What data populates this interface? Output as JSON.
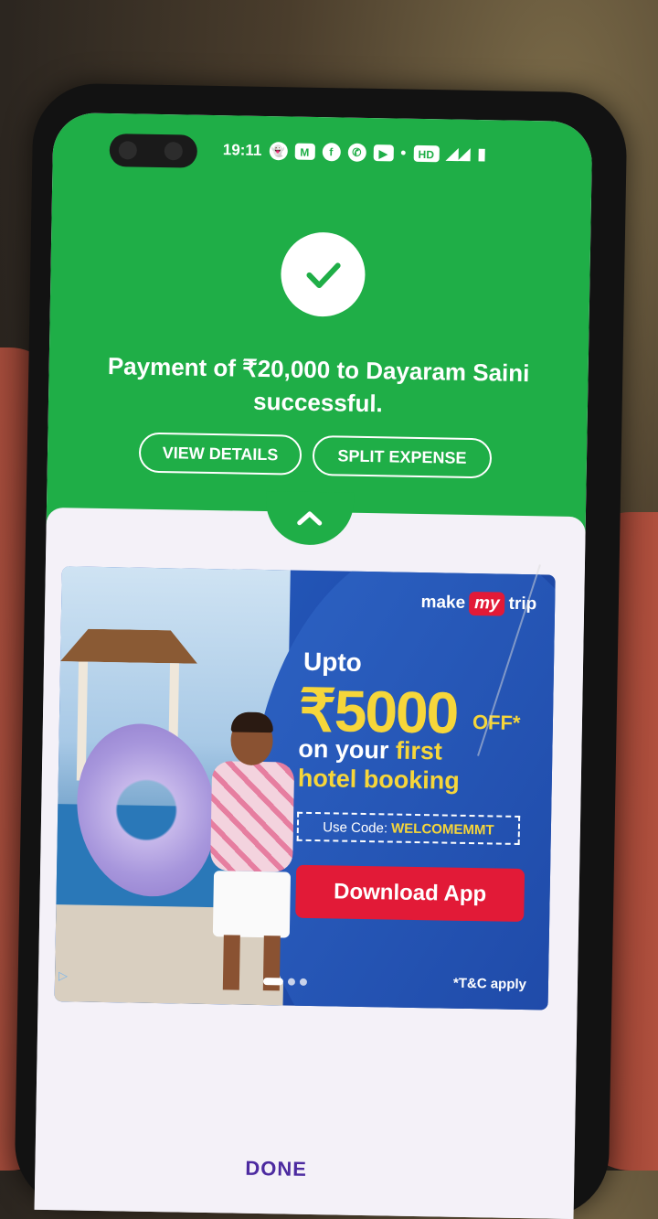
{
  "status_bar": {
    "time": "19:11",
    "icons": [
      "snapchat-icon",
      "m-icon",
      "facebook-icon",
      "phone-icon",
      "youtube-icon",
      "dot-icon",
      "volte-icon",
      "signal-icon",
      "battery-icon"
    ]
  },
  "payment": {
    "message": "Payment of ₹20,000 to Dayaram Saini successful.",
    "view_details": "VIEW DETAILS",
    "split_expense": "SPLIT EXPENSE"
  },
  "ad": {
    "brand_make": "make",
    "brand_my": "my",
    "brand_trip": "trip",
    "upto": "Upto",
    "amount": "₹5000",
    "off": "OFF*",
    "line1_prefix": "on your",
    "line1_highlight": "first",
    "line2": "hotel booking",
    "code_label": "Use Code:",
    "code_value": "WELCOMEMMT",
    "download": "Download App",
    "tc": "*T&C apply",
    "carousel_active": 1,
    "carousel_count": 3
  },
  "footer": {
    "done": "DONE"
  },
  "colors": {
    "green": "#1fae47",
    "brand_red": "#e21a37",
    "highlight_yellow": "#f6d63a",
    "ad_blue": "#1f4fb0"
  }
}
